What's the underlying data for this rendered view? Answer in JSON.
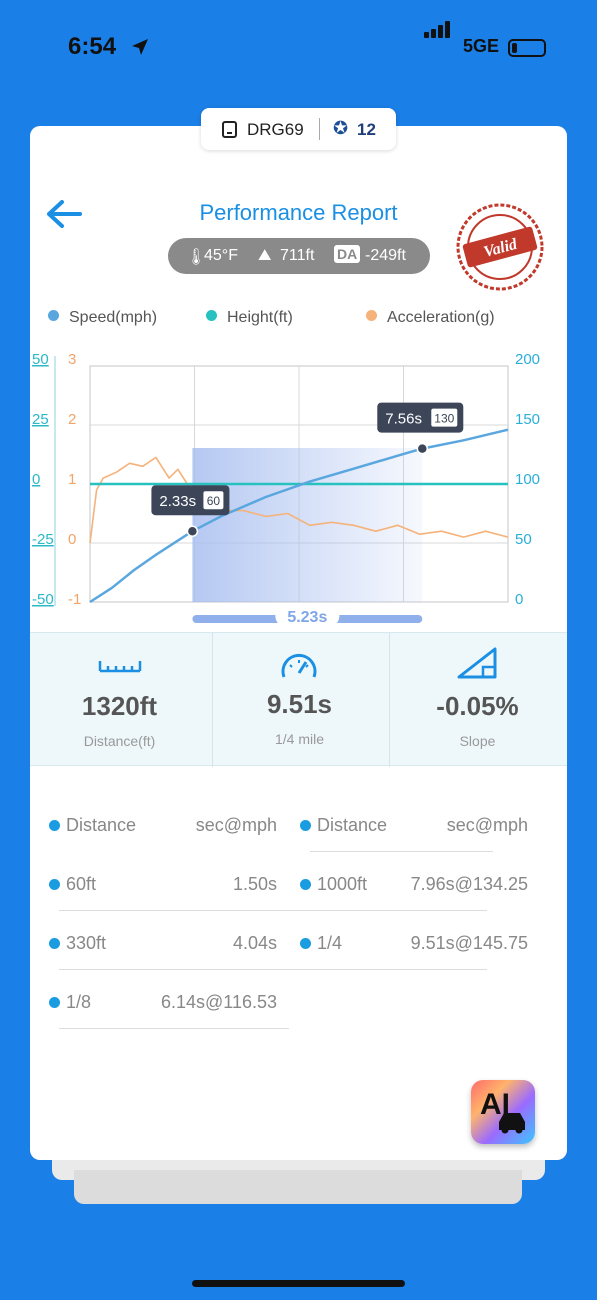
{
  "status_bar": {
    "time": "6:54",
    "network": "5GE"
  },
  "device": {
    "name": "DRG69",
    "badge_count": "12"
  },
  "header": {
    "title": "Performance Report",
    "stamp_text": "Valid"
  },
  "conditions": {
    "temperature": "45°F",
    "altitude": "711ft",
    "da_label": "DA",
    "density_altitude": "-249ft"
  },
  "legend": [
    {
      "label": "Speed(mph)",
      "color": "#5aa7df"
    },
    {
      "label": "Height(ft)",
      "color": "#27c2c0"
    },
    {
      "label": "Acceleration(g)",
      "color": "#f5b27a"
    }
  ],
  "chart_data": {
    "type": "line",
    "x_range_s": [
      0,
      9.51
    ],
    "left_axis_height": {
      "ticks": [
        "50",
        "25",
        "0",
        "-25",
        "-50"
      ],
      "ylim": [
        -50,
        50
      ]
    },
    "left_axis_acceleration": {
      "ticks": [
        "3",
        "2",
        "1",
        "0",
        "-1"
      ],
      "ylim": [
        -1,
        3
      ]
    },
    "right_axis_speed": {
      "ticks": [
        "200",
        "150",
        "100",
        "50",
        "0"
      ],
      "ylim": [
        0,
        200
      ]
    },
    "series": [
      {
        "name": "Speed(mph)",
        "axis": "right",
        "color": "#5aa7df",
        "x": [
          0,
          0.5,
          1.0,
          1.5,
          2.0,
          2.33,
          3.0,
          4.0,
          5.0,
          6.0,
          7.0,
          7.56,
          8.5,
          9.51
        ],
        "y": [
          0,
          12,
          27,
          40,
          52,
          60,
          73,
          89,
          102,
          113,
          124,
          130,
          137,
          146
        ]
      },
      {
        "name": "Height(ft)",
        "axis": "left",
        "color": "#27c2c0",
        "x": [
          0,
          9.51
        ],
        "y": [
          0,
          0
        ]
      },
      {
        "name": "Acceleration(g)",
        "axis": "left2",
        "color": "#f5b27a",
        "x": [
          0,
          0.15,
          0.3,
          0.6,
          0.9,
          1.2,
          1.5,
          1.8,
          2.0,
          2.3,
          2.6,
          3.0,
          3.5,
          4.0,
          4.5,
          5.0,
          5.5,
          6.0,
          6.5,
          7.0,
          7.5,
          8.0,
          8.5,
          9.0,
          9.51
        ],
        "y": [
          0,
          0.9,
          1.1,
          1.2,
          1.35,
          1.3,
          1.45,
          1.1,
          1.25,
          0.9,
          0.95,
          0.55,
          0.55,
          0.45,
          0.5,
          0.3,
          0.35,
          0.3,
          0.2,
          0.3,
          0.15,
          0.2,
          0.1,
          0.2,
          0.1
        ]
      }
    ],
    "markers": [
      {
        "time": "2.33s",
        "speed": "60",
        "x": 2.33,
        "y": 60
      },
      {
        "time": "7.56s",
        "speed": "130",
        "x": 7.56,
        "y": 130
      }
    ],
    "range_label": "5.23s",
    "range": [
      2.33,
      7.56
    ],
    "grid": true
  },
  "stats": [
    {
      "value": "1320ft",
      "label": "Distance(ft)",
      "icon": "ruler-icon"
    },
    {
      "value": "9.51s",
      "label": "1/4 mile",
      "icon": "speedometer-icon"
    },
    {
      "value": "-0.05%",
      "label": "Slope",
      "icon": "slope-icon"
    }
  ],
  "table": {
    "header": {
      "distance": "Distance",
      "unit": "sec@mph"
    },
    "left": [
      {
        "distance": "60ft",
        "value": "1.50s"
      },
      {
        "distance": "330ft",
        "value": "4.04s"
      },
      {
        "distance": "1/8",
        "value": "6.14s@116.53"
      }
    ],
    "right": [
      {
        "distance": "1000ft",
        "value": "7.96s@134.25"
      },
      {
        "distance": "1/4",
        "value": "9.51s@145.75"
      }
    ]
  },
  "ai_button": {
    "label": "AI"
  }
}
